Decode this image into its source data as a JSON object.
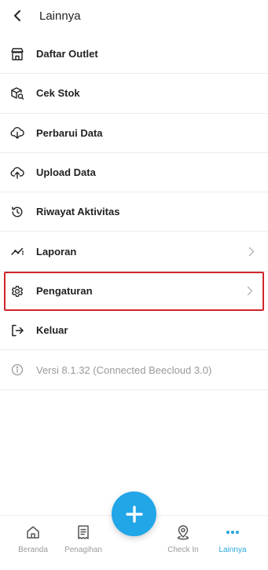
{
  "header": {
    "title": "Lainnya"
  },
  "menu": {
    "items": [
      {
        "label": "Daftar Outlet"
      },
      {
        "label": "Cek Stok"
      },
      {
        "label": "Perbarui Data"
      },
      {
        "label": "Upload Data"
      },
      {
        "label": "Riwayat Aktivitas"
      },
      {
        "label": "Laporan"
      },
      {
        "label": "Pengaturan"
      },
      {
        "label": "Keluar"
      },
      {
        "label": "Versi 8.1.32 (Connected Beecloud 3.0)"
      }
    ]
  },
  "bottom_nav": {
    "items": [
      {
        "label": "Beranda"
      },
      {
        "label": "Penagihan"
      },
      {
        "label": "Check In"
      },
      {
        "label": "Lainnya"
      }
    ],
    "active": "Lainnya"
  },
  "colors": {
    "accent": "#21a6e8",
    "highlight_border": "#d0262b",
    "active_nav": "#2aa8df"
  }
}
